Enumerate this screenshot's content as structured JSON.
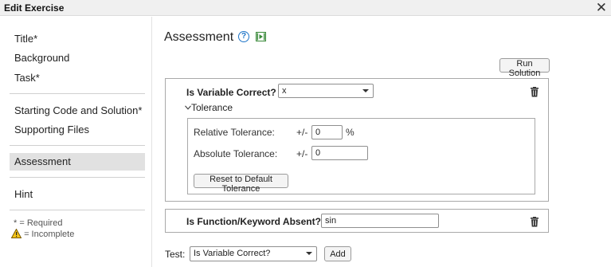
{
  "window": {
    "title": "Edit Exercise"
  },
  "sidebar": {
    "items": [
      {
        "label": "Title*"
      },
      {
        "label": "Background"
      },
      {
        "label": "Task*"
      },
      {
        "label": "Starting Code and Solution*"
      },
      {
        "label": "Supporting Files"
      },
      {
        "label": "Assessment"
      },
      {
        "label": "Hint"
      }
    ],
    "legend_required": "* = Required",
    "legend_incomplete": "= Incomplete"
  },
  "main": {
    "heading": "Assessment",
    "run_solution_label": "Run Solution",
    "test1": {
      "label": "Is Variable Correct?",
      "variable_value": "x",
      "tolerance_label": "Tolerance",
      "relative_label": "Relative Tolerance:",
      "relative_pm": "+/-",
      "relative_value": "0",
      "relative_unit": "%",
      "absolute_label": "Absolute Tolerance:",
      "absolute_pm": "+/-",
      "absolute_value": "0",
      "reset_label": "Reset to Default Tolerance"
    },
    "test2": {
      "label": "Is Function/Keyword Absent?",
      "value": "sin"
    },
    "footer": {
      "test_label": "Test:",
      "test_select_value": "Is Variable Correct?",
      "add_label": "Add"
    }
  }
}
